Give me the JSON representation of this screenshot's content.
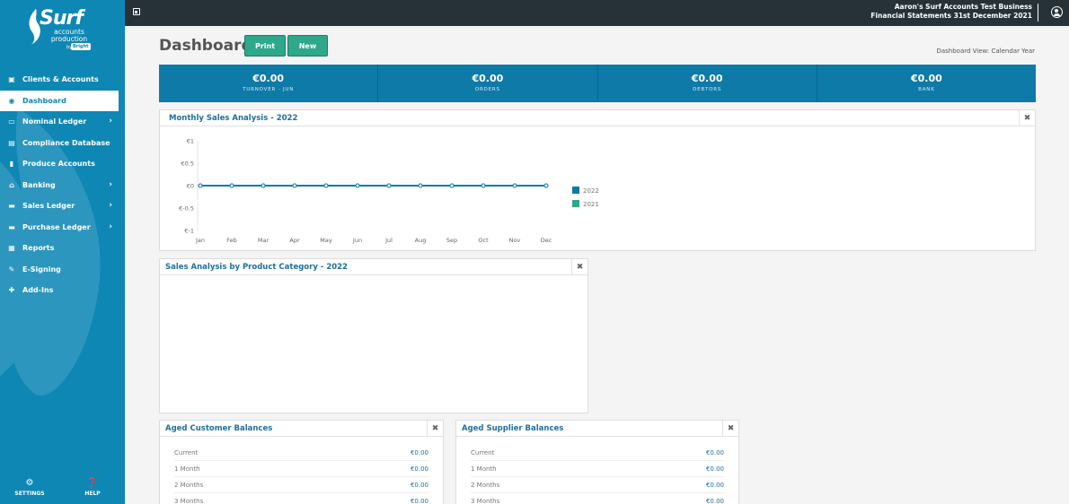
{
  "brand": {
    "logo_text": "Surf",
    "logo_sub_1": "accounts",
    "logo_sub_2": "production",
    "logo_by": "by",
    "logo_bright": "Bright"
  },
  "sidebar": {
    "items": [
      {
        "label": "Clients & Accounts",
        "icon": "clients-icon",
        "chevron": false
      },
      {
        "label": "Dashboard",
        "icon": "dashboard-icon",
        "chevron": false,
        "active": true
      },
      {
        "label": "Nominal Ledger",
        "icon": "ledger-icon",
        "chevron": true
      },
      {
        "label": "Compliance Database",
        "icon": "database-icon",
        "chevron": false
      },
      {
        "label": "Produce Accounts",
        "icon": "document-icon",
        "chevron": false
      },
      {
        "label": "Banking",
        "icon": "bank-icon",
        "chevron": true
      },
      {
        "label": "Sales Ledger",
        "icon": "sales-icon",
        "chevron": true
      },
      {
        "label": "Purchase Ledger",
        "icon": "purchase-icon",
        "chevron": true
      },
      {
        "label": "Reports",
        "icon": "reports-icon",
        "chevron": false
      },
      {
        "label": "E-Signing",
        "icon": "signing-icon",
        "chevron": false
      },
      {
        "label": "Add-Ins",
        "icon": "addins-icon",
        "chevron": false
      }
    ],
    "settings_label": "SETTINGS",
    "help_label": "HELP"
  },
  "topbar": {
    "business_name": "Aaron's Surf Accounts Test Business",
    "statements_label": "Financial Statements 31st December 2021"
  },
  "header": {
    "title": "Dashboard",
    "print_label": "Print",
    "new_label": "New",
    "view_label": "Dashboard View: Calendar Year"
  },
  "stats": [
    {
      "value": "€0.00",
      "label": "TURNOVER - JUN"
    },
    {
      "value": "€0.00",
      "label": "ORDERS"
    },
    {
      "value": "€0.00",
      "label": "DEBTORS"
    },
    {
      "value": "€0.00",
      "label": "BANK"
    }
  ],
  "panels": {
    "monthly_title": "Monthly Sales Analysis - 2022",
    "product_title": "Sales Analysis by Product Category - 2022",
    "customer_title": "Aged Customer Balances",
    "supplier_title": "Aged Supplier Balances",
    "close_glyph": "✖"
  },
  "chart_data": {
    "type": "line",
    "categories": [
      "Jan",
      "Feb",
      "Mar",
      "Apr",
      "May",
      "Jun",
      "Jul",
      "Aug",
      "Sep",
      "Oct",
      "Nov",
      "Dec"
    ],
    "series": [
      {
        "name": "2022",
        "values": [
          0,
          0,
          0,
          0,
          0,
          0,
          0,
          0,
          0,
          0,
          0,
          0
        ],
        "color": "#0e7aa8"
      },
      {
        "name": "2021",
        "values": [
          0,
          0,
          0,
          0,
          0,
          0,
          0,
          0,
          0,
          0,
          0,
          0
        ],
        "color": "#2ea88a"
      }
    ],
    "ytick_labels": [
      "€1",
      "€0.5",
      "€0",
      "€-0.5",
      "€-1"
    ],
    "ytick_values": [
      1,
      0.5,
      0,
      -0.5,
      -1
    ],
    "ylim": [
      -1,
      1
    ],
    "legend": "right"
  },
  "aged_customer": [
    {
      "label": "Current",
      "value": "€0.00"
    },
    {
      "label": "1 Month",
      "value": "€0.00"
    },
    {
      "label": "2 Months",
      "value": "€0.00"
    },
    {
      "label": "3 Months",
      "value": "€0.00"
    }
  ],
  "aged_supplier": [
    {
      "label": "Current",
      "value": "€0.00"
    },
    {
      "label": "1 Month",
      "value": "€0.00"
    },
    {
      "label": "2 Months",
      "value": "€0.00"
    },
    {
      "label": "3 Months",
      "value": "€0.00"
    }
  ]
}
